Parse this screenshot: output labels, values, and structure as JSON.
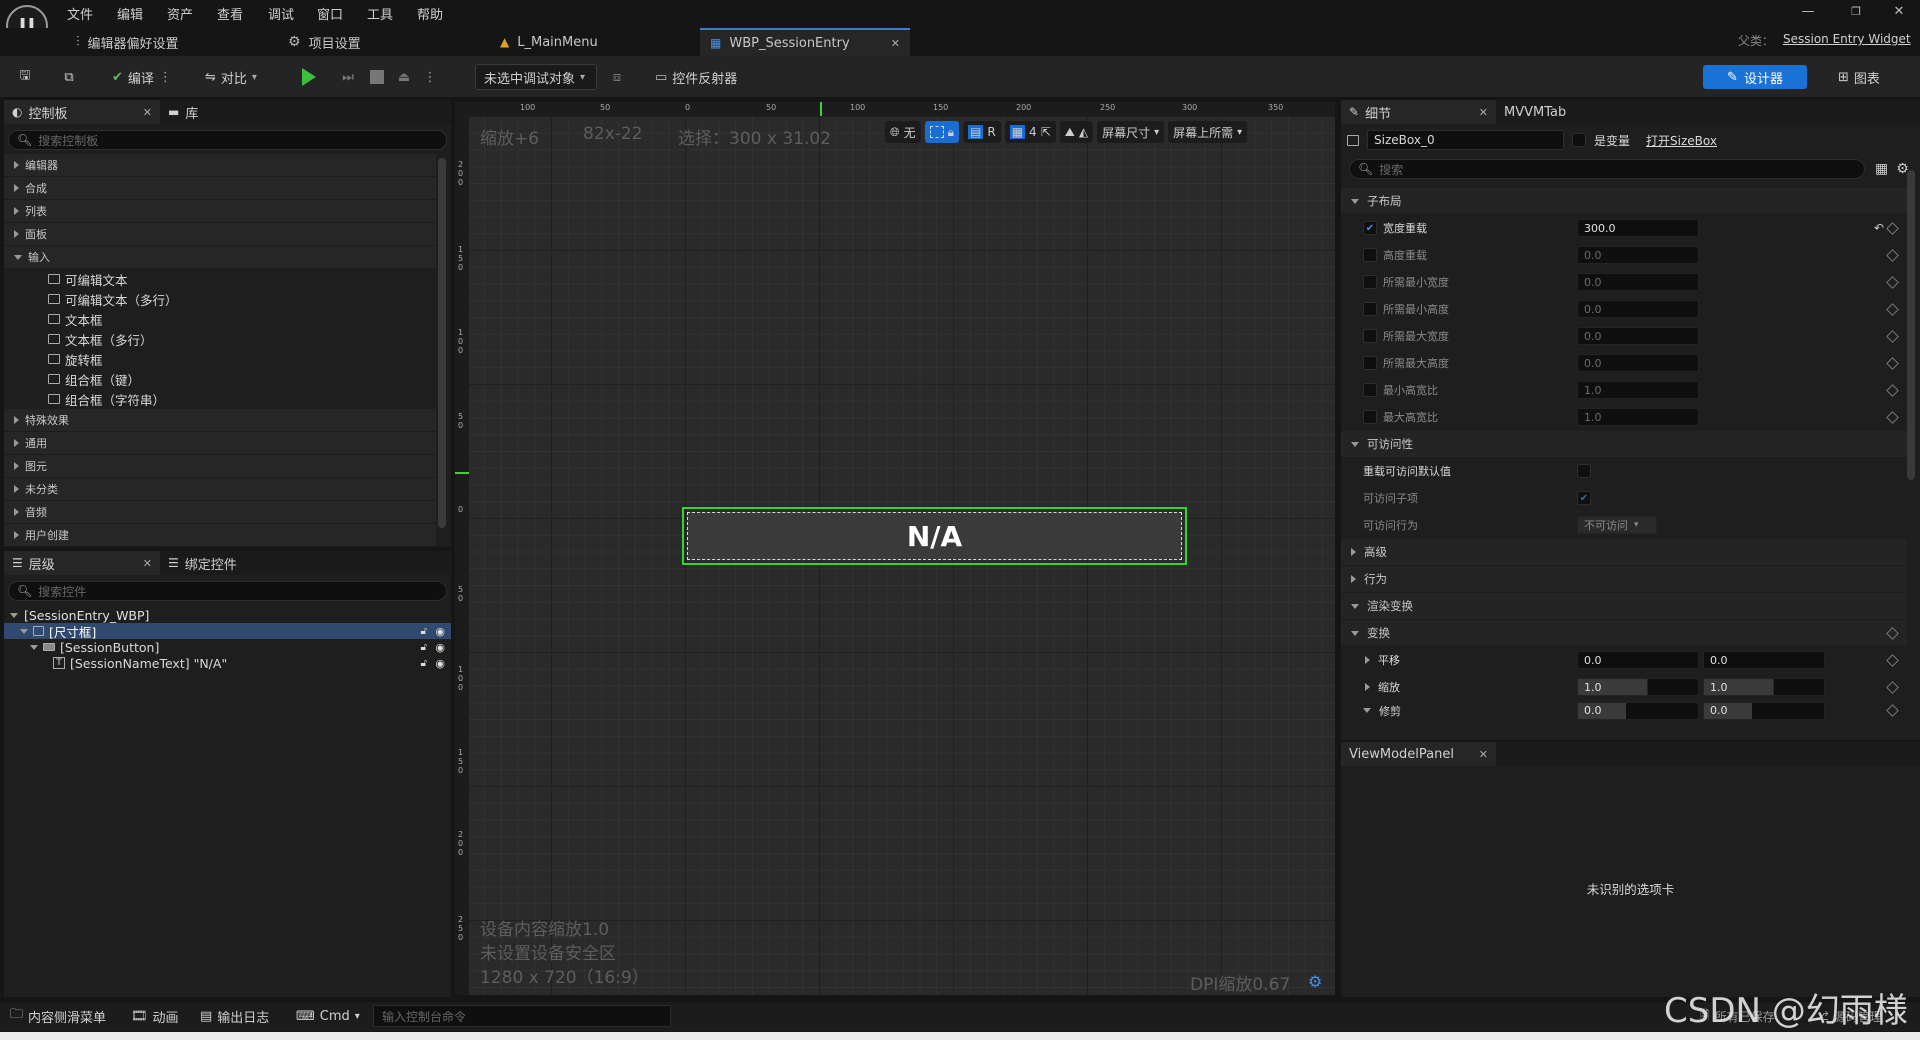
{
  "menubar": {
    "items": [
      "文件",
      "编辑",
      "资产",
      "查看",
      "调试",
      "窗口",
      "工具",
      "帮助"
    ]
  },
  "window": {
    "parent_label": "父类：",
    "parent_value": "Session Entry Widget"
  },
  "tabs": {
    "editor_prefs": "编辑器偏好设置",
    "project_settings": "项目设置",
    "main_menu": "L_MainMenu",
    "session_entry": "WBP_SessionEntry"
  },
  "toolbar": {
    "compile": "编译",
    "diff": "对比",
    "debug_target": "未选中调试对象",
    "widget_reflector": "控件反射器",
    "designer": "设计器",
    "graph": "图表"
  },
  "palette": {
    "tab_label": "控制板",
    "library_label": "库",
    "search_placeholder": "搜索控制板",
    "cat_editor": "编辑器",
    "cat_composite": "合成",
    "cat_list": "列表",
    "cat_panel": "面板",
    "cat_input": "输入",
    "input_items": [
      "可编辑文本",
      "可编辑文本（多行）",
      "文本框",
      "文本框（多行）",
      "旋转框",
      "组合框（键）",
      "组合框（字符串）"
    ],
    "cat_special": "特殊效果",
    "cat_common": "通用",
    "cat_primitive": "图元",
    "cat_uncat": "未分类",
    "cat_audio": "音频",
    "cat_user": "用户创建"
  },
  "hierarchy": {
    "tab_label": "层级",
    "bind_label": "绑定控件",
    "search_placeholder": "搜索控件",
    "root": "[SessionEntry_WBP]",
    "sizebox": "[尺寸框]",
    "button": "[SessionButton]",
    "text": "[SessionNameText] \"N/A\""
  },
  "viewport": {
    "zoom": "缩放+6",
    "size": "82x-22",
    "selection": "选择：300 x 31.02",
    "toggle_none": "无",
    "r_label": "R",
    "grid_value": "4",
    "screen_size": "屏幕尺寸",
    "fill_mode": "屏幕上所需",
    "widget_text": "N/A",
    "device_scale": "设备内容缩放1.0",
    "safe_zone": "未设置设备安全区",
    "resolution": "1280 x 720（16:9）",
    "dpi": "DPI缩放0.67",
    "hruler_labels": [
      "100",
      "50",
      "0",
      "50",
      "100",
      "150",
      "200",
      "250",
      "300",
      "350"
    ],
    "vruler_labels": [
      "200",
      "150",
      "100",
      "50",
      "0",
      "50",
      "100",
      "150",
      "200",
      "250"
    ]
  },
  "details": {
    "tab_label": "细节",
    "mvvm_tab": "MVVMTab",
    "widget_name": "SizeBox_0",
    "is_variable": "是变量",
    "open_link": "打开SizeBox",
    "search_placeholder": "搜索",
    "section_child_layout": "子布局",
    "width_override": "宽度重载",
    "width_value": "300.0",
    "height_override": "高度重载",
    "height_value": "0.0",
    "min_desired_width": "所需最小宽度",
    "min_desired_width_value": "0.0",
    "min_desired_height": "所需最小高度",
    "min_desired_height_value": "0.0",
    "max_desired_width": "所需最大宽度",
    "max_desired_width_value": "0.0",
    "max_desired_height": "所需最大高度",
    "max_desired_height_value": "0.0",
    "min_aspect": "最小高宽比",
    "min_aspect_value": "1.0",
    "max_aspect": "最大高宽比",
    "max_aspect_value": "1.0",
    "section_accessibility": "可访问性",
    "override_accessible": "重载可访问默认值",
    "accessible_children": "可访问子项",
    "accessible_behavior": "可访问行为",
    "accessible_behavior_value": "不可访问",
    "section_advanced": "高级",
    "section_behavior": "行为",
    "section_render_transform": "渲染变换",
    "section_transform": "变换",
    "translation": "平移",
    "translation_x": "0.0",
    "translation_y": "0.0",
    "scale": "缩放",
    "scale_x": "1.0",
    "scale_y": "1.0",
    "shear": "修剪",
    "shear_x": "0.0",
    "shear_y": "0.0"
  },
  "viewmodel": {
    "tab_label": "ViewModelPanel",
    "message": "未识别的选项卡"
  },
  "bottombar": {
    "content_drawer": "内容侧滑菜单",
    "animation": "动画",
    "output_log": "输出日志",
    "cmd": "Cmd",
    "console_placeholder": "输入控制台命令",
    "save_status": "所有已保存",
    "source_control": "源码管理"
  },
  "watermark": "CSDN @幻雨様"
}
